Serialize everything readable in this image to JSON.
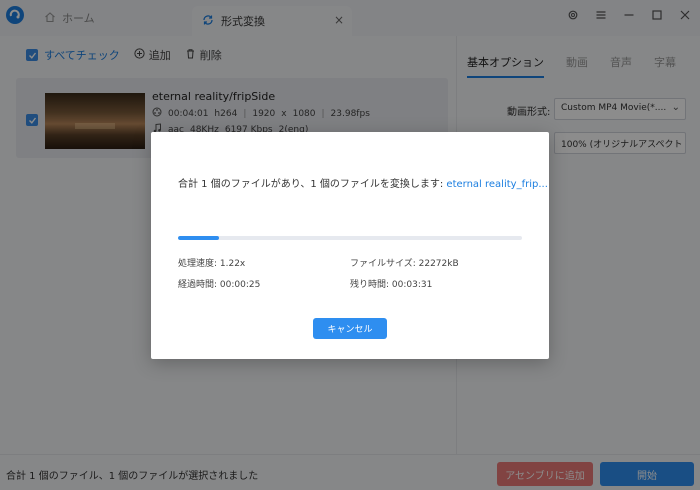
{
  "titlebar": {
    "home_tab_label": "ホーム",
    "convert_tab_label": "形式変換",
    "tab_close": "×"
  },
  "toolbar": {
    "check_all_label": "すべてチェック",
    "add_label": "追加",
    "delete_label": "削除"
  },
  "file": {
    "title": "eternal reality/fripSide",
    "duration": "00:04:01",
    "video_codec": "h264",
    "width": "1920",
    "x": "x",
    "height": "1080",
    "fps": "23.98fps",
    "audio_codec": "aac",
    "sample_rate": "48KHz",
    "bitrate": "6197 Kbps",
    "channels": "2(eng)",
    "sep": "|"
  },
  "options": {
    "tabs": [
      "基本オプション",
      "動画",
      "音声",
      "字幕"
    ],
    "active_tab": 0,
    "format_label": "動画形式:",
    "format_value": "Custom MP4 Movie(*....",
    "resolution_value": "100% (オリジナルアスペクト"
  },
  "dialog": {
    "message": "合計 1 個のファイルがあり、1 個のファイルを変換します: ",
    "filename": "eternal reality_frip...",
    "progress": 0.12,
    "speed_label": "処理速度: 1.22x",
    "filesize_label": "ファイルサイズ: 22272kB",
    "elapsed_label": "経過時間: 00:00:25",
    "remaining_label": "残り時間: 00:03:31",
    "cancel_label": "キャンセル"
  },
  "bottombar": {
    "status_text": "合計 1 個のファイル、1 個のファイルが選択されました",
    "assembly_label": "アセンブリに追加",
    "start_label": "開始"
  },
  "colors": {
    "accent": "#2e8ef0",
    "assembly": "#eb7a78"
  },
  "icons": {
    "app_logo": "app-logo-icon",
    "home": "home-icon",
    "convert": "convert-icon",
    "settings": "gear-icon",
    "menu": "menu-icon",
    "minimize": "minimize-icon",
    "maximize": "maximize-icon",
    "close": "close-icon"
  }
}
